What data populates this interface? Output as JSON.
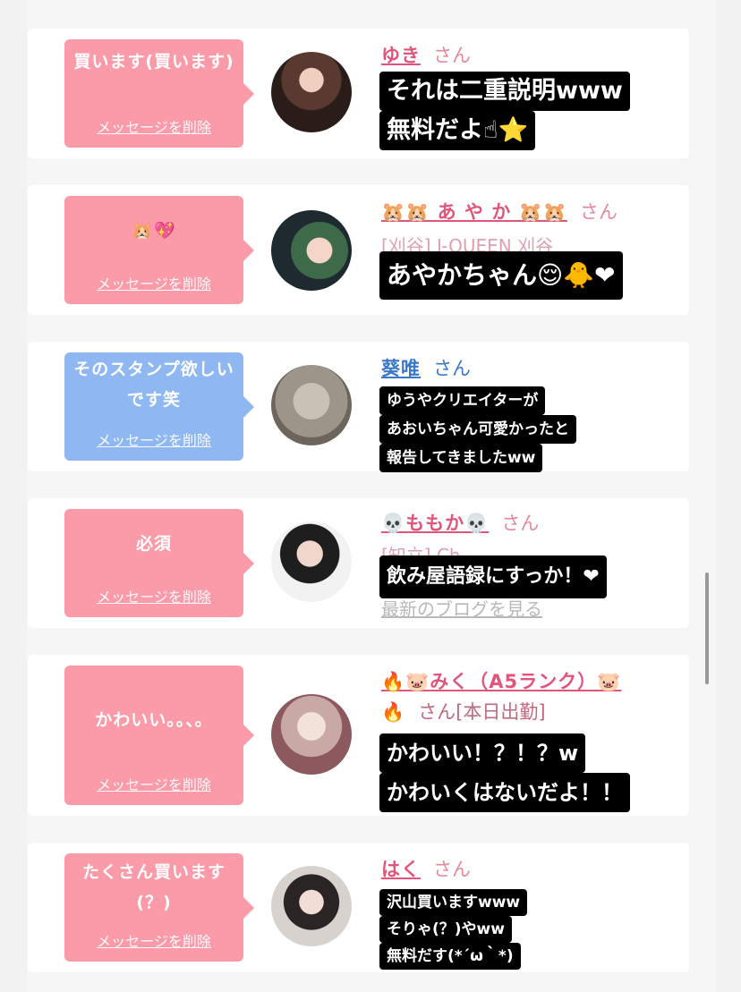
{
  "messages": [
    {
      "bubble_text": "買います(買います)",
      "delete_label": "メッセージを削除",
      "name": "ゆき",
      "honorific": "さん",
      "caption": [
        "それは二重説明www",
        "無料だよ☝⭐"
      ]
    },
    {
      "bubble_text": "🐹💖",
      "delete_label": "メッセージを削除",
      "name": "🐹🐹 あ や か 🐹🐹",
      "honorific": "さん",
      "subtext": "[刈谷] J-QUEEN 刈谷",
      "caption": [
        "あやかちゃん😌🐥❤"
      ]
    },
    {
      "bubble_text": "そのスタンプ欲しいです笑",
      "delete_label": "メッセージを削除",
      "name": "葵唯",
      "honorific": "さん",
      "caption": [
        "ゆうやクリエイターが",
        "あおいちゃん可愛かったと",
        "報告してきましたww"
      ]
    },
    {
      "bubble_text": "必須",
      "delete_label": "メッセージを削除",
      "name": "💀ももか💀",
      "honorific": "さん",
      "subtext": "[知立] Ch...",
      "link": "最新のブログを見る",
      "caption": [
        "飲み屋語録にすっか！❤"
      ]
    },
    {
      "bubble_text": "かわいい。。、。",
      "delete_label": "メッセージを削除",
      "name": "🔥🐷みく（A5ランク）🐷",
      "name2": "🔥",
      "honorific": "さん[本日出勤]",
      "caption": [
        "かわいい！？！？w",
        "かわいくはないだよ！！"
      ]
    },
    {
      "bubble_text": "たくさん買います(？)",
      "delete_label": "メッセージを削除",
      "name": "はく",
      "honorific": "さん",
      "caption": [
        "沢山買いますwww",
        "そりゃ(？)やww",
        "無料だす(*´ω｀*)"
      ]
    }
  ],
  "colors": {
    "pink_bubble": "#fb9aa8",
    "blue_bubble": "#8fb7f2",
    "pink_name": "#e0567a",
    "blue_name": "#3a78c8"
  }
}
